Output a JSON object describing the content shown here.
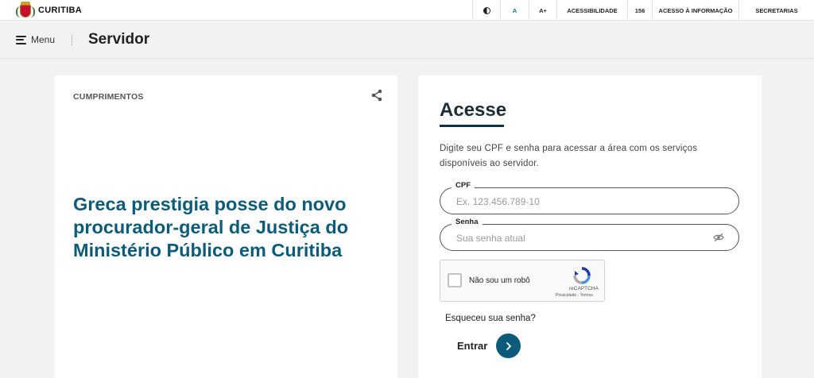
{
  "topbar": {
    "brand": "CURITIBA",
    "font_normal": "A",
    "font_increase": "A+",
    "accessibility": "ACESSIBILIDADE",
    "phone": "156",
    "info_access": "ACESSO À INFORMAÇÃO",
    "secretaries": "SECRETARIAS"
  },
  "header": {
    "menu_label": "Menu",
    "page_title": "Servidor"
  },
  "news": {
    "category": "CUMPRIMENTOS",
    "title": "Greca prestigia posse do novo procurador-geral de Justiça do Ministério Público em Curitiba"
  },
  "login": {
    "title": "Acesse",
    "description": "Digite seu CPF e senha para acessar a área com os serviços disponíveis ao servidor.",
    "cpf_label": "CPF",
    "cpf_placeholder": "Ex. 123.456.789-10",
    "password_label": "Senha",
    "password_placeholder": "Sua senha atual",
    "forgot_password": "Esqueceu sua senha?",
    "submit_label": "Entrar"
  },
  "captcha": {
    "label": "Não sou um robô",
    "brand": "reCAPTCHA",
    "links": "Privacidade - Termos"
  },
  "colors": {
    "accent": "#0c5b7a",
    "background": "#f2f2f2",
    "card": "#ffffff"
  },
  "icons": {
    "contrast": "contrast-icon",
    "menu": "hamburger-icon",
    "share": "share-icon",
    "password_toggle": "eye-off-icon",
    "submit": "chevron-right-icon"
  }
}
